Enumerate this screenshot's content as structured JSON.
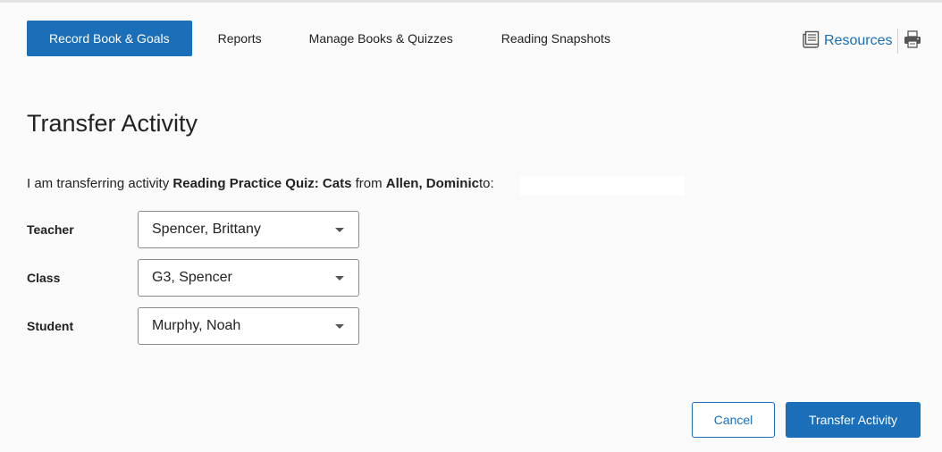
{
  "nav": {
    "tabs": [
      {
        "label": "Record Book & Goals",
        "active": true
      },
      {
        "label": "Reports",
        "active": false
      },
      {
        "label": "Manage Books & Quizzes",
        "active": false
      },
      {
        "label": "Reading Snapshots",
        "active": false
      }
    ],
    "resources_label": "Resources"
  },
  "page": {
    "title": "Transfer Activity",
    "sentence": {
      "prefix": "I am transferring activity",
      "activity": "Reading Practice Quiz: Cats",
      "from_word": "from",
      "student": "Allen, Dominic",
      "to_word": "to:"
    }
  },
  "form": {
    "teacher": {
      "label": "Teacher",
      "value": "Spencer, Brittany"
    },
    "class": {
      "label": "Class",
      "value": "G3, Spencer"
    },
    "student": {
      "label": "Student",
      "value": "Murphy, Noah"
    }
  },
  "actions": {
    "cancel_label": "Cancel",
    "transfer_label": "Transfer Activity"
  },
  "colors": {
    "accent": "#1a6fb8",
    "background": "#fafafa"
  },
  "icons": {
    "resources": "resources-icon",
    "print": "print-icon",
    "dropdown": "chevron-down-icon"
  }
}
